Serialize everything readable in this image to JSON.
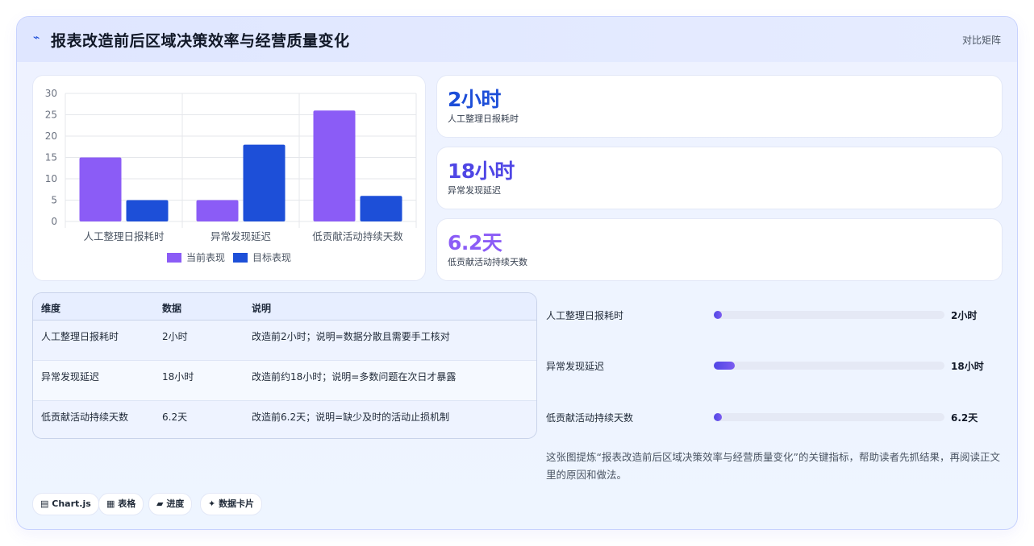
{
  "header": {
    "icon": "trend-icon",
    "title": "报表改造前后区域决策效率与经营质量变化",
    "right_label": "对比矩阵"
  },
  "chart_data": {
    "type": "bar",
    "categories": [
      "人工整理日报耗时",
      "异常发现延迟",
      "低贡献活动持续天数"
    ],
    "series": [
      {
        "name": "当前表现",
        "values": [
          15,
          5,
          26
        ],
        "color": "#8b5cf6"
      },
      {
        "name": "目标表现",
        "values": [
          5,
          18,
          6
        ],
        "color": "#1d4fd8"
      }
    ],
    "yticks": [
      0,
      5,
      10,
      15,
      20,
      25,
      30
    ],
    "ylim": [
      0,
      30
    ],
    "legend": "bottom",
    "grid": true
  },
  "stats": [
    {
      "value": "2小时",
      "label": "人工整理日报耗时",
      "color": "#1d4ed8"
    },
    {
      "value": "18小时",
      "label": "异常发现延迟",
      "color": "#4f46e5"
    },
    {
      "value": "6.2天",
      "label": "低贡献活动持续天数",
      "color": "#8b5cf6"
    }
  ],
  "table": {
    "headers": [
      "维度",
      "数据",
      "说明"
    ],
    "rows": [
      [
        "人工整理日报耗时",
        "2小时",
        "改造前2小时；说明=数据分散且需要手工核对"
      ],
      [
        "异常发现延迟",
        "18小时",
        "改造前约18小时；说明=多数问题在次日才暴露"
      ],
      [
        "低贡献活动持续天数",
        "6.2天",
        "改造前6.2天；说明=缺少及时的活动止损机制"
      ]
    ]
  },
  "progress": [
    {
      "label": "人工整理日报耗时",
      "value": "2小时",
      "fraction": 0.02
    },
    {
      "label": "异常发现延迟",
      "value": "18小时",
      "fraction": 0.09
    },
    {
      "label": "低贡献活动持续天数",
      "value": "6.2天",
      "fraction": 0.02
    }
  ],
  "note": "这张图提炼“报表改造前后区域决策效率与经营质量变化”的关键指标，帮助读者先抓结果，再阅读正文里的原因和做法。",
  "tags": [
    {
      "icon": "chart-icon",
      "glyph": "▤",
      "label": "Chart.js"
    },
    {
      "icon": "table-icon",
      "glyph": "▦",
      "label": "表格"
    },
    {
      "icon": "progress-icon",
      "glyph": "▰",
      "label": "进度"
    },
    {
      "icon": "sparkle-icon",
      "glyph": "✦",
      "label": "数据卡片"
    }
  ]
}
